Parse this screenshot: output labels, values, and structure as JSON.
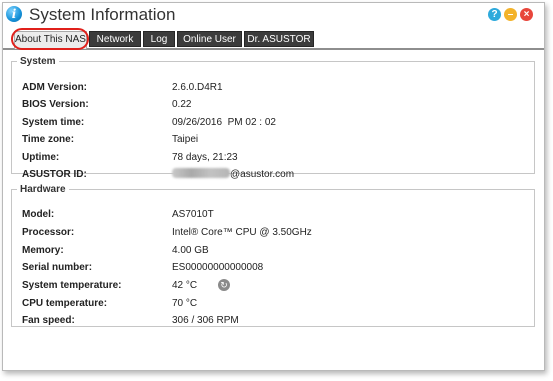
{
  "window": {
    "title": "System Information",
    "app_icon": "info-icon",
    "controls": [
      "help-icon",
      "minimize-icon",
      "close-icon"
    ]
  },
  "tabs": [
    {
      "label": "About This NAS",
      "active": true
    },
    {
      "label": "Network",
      "active": false
    },
    {
      "label": "Log",
      "active": false
    },
    {
      "label": "Online User",
      "active": false
    },
    {
      "label": "Dr. ASUSTOR",
      "active": false
    }
  ],
  "system": {
    "legend": "System",
    "rows": [
      {
        "label": "ADM Version:",
        "value": "2.6.0.D4R1"
      },
      {
        "label": "BIOS Version:",
        "value": "0.22"
      },
      {
        "label": "System time:",
        "value": "09/26/2016  PM 02 : 02"
      },
      {
        "label": "Time zone:",
        "value": "Taipei"
      },
      {
        "label": "Uptime:",
        "value": "78 days, 21:23"
      },
      {
        "label": "ASUSTOR ID:",
        "value": "@asustor.com"
      }
    ]
  },
  "hardware": {
    "legend": "Hardware",
    "rows": [
      {
        "label": "Model:",
        "value": "AS7010T"
      },
      {
        "label": "Processor:",
        "value": "Intel® Core™ CPU @ 3.50GHz"
      },
      {
        "label": "Memory:",
        "value": "4.00 GB"
      },
      {
        "label": "Serial number:",
        "value": "ES00000000000008"
      },
      {
        "label": "System temperature:",
        "value": "42 °C"
      },
      {
        "label": "CPU temperature:",
        "value": "70 °C"
      },
      {
        "label": "Fan speed:",
        "value": "306 / 306 RPM"
      }
    ]
  },
  "colors": {
    "highlight": "#e0201b",
    "tab_dark": "#3c3c3c",
    "tab_active": "#ececec"
  }
}
